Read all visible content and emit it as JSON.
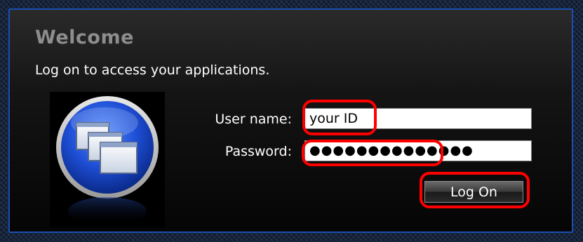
{
  "dialog": {
    "title": "Welcome",
    "subtitle": "Log on to access your applications."
  },
  "form": {
    "username_label": "User name:",
    "username_value": "your ID",
    "password_label": "Password:",
    "password_value": "●●●●●●●●●●●●●●",
    "logon_label": "Log On"
  },
  "logo": {
    "icon": "application-windows-icon"
  },
  "colors": {
    "accent_border": "#1a4fb0",
    "highlight": "#ff0000",
    "title_text": "#8d8d8d",
    "logo_blue": "#1f4fd6"
  }
}
